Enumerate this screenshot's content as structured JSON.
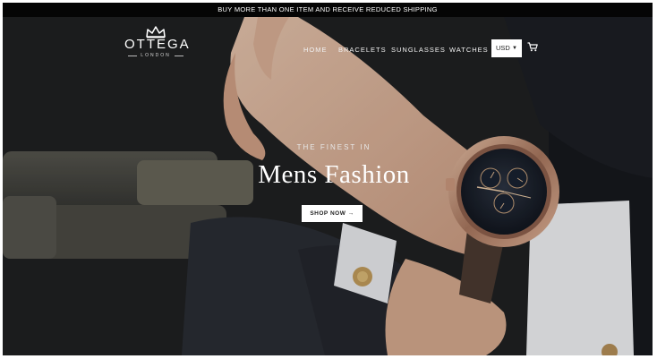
{
  "announcement": {
    "text": "BUY MORE THAN ONE ITEM AND RECEIVE REDUCED SHIPPING"
  },
  "brand": {
    "name": "OTTEGA",
    "location": "LONDON"
  },
  "nav": {
    "items": [
      {
        "label": "HOME"
      },
      {
        "label": "BRACELETS"
      },
      {
        "label": "SUNGLASSES"
      },
      {
        "label": "WATCHES"
      }
    ],
    "currency": {
      "selected": "USD"
    },
    "icons": {
      "cart": "cart-icon",
      "crown": "crown-icon"
    }
  },
  "hero": {
    "tagline": "THE FINEST IN",
    "headline": "Mens Fashion",
    "cta_label": "SHOP NOW →"
  },
  "colors": {
    "announce_bg": "#050505",
    "text_light": "#ffffff",
    "button_bg": "#ffffff"
  }
}
